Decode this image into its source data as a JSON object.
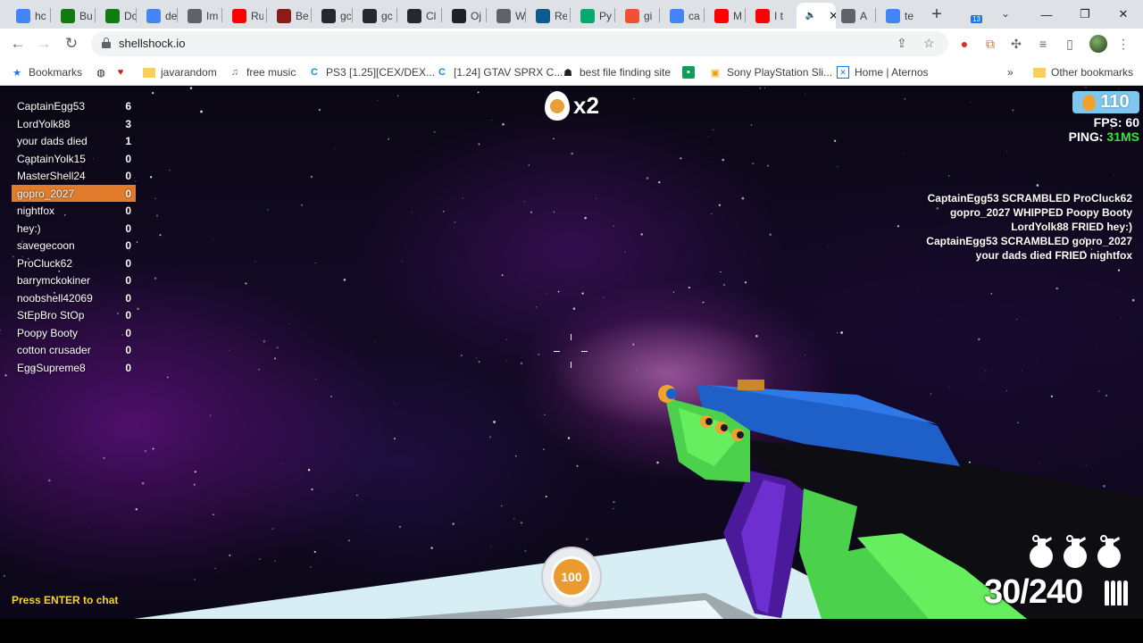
{
  "browser": {
    "tabs": [
      {
        "title": "hc",
        "icon": "google-icon",
        "color": "#4285f4"
      },
      {
        "title": "Bu",
        "icon": "xbox-icon",
        "color": "#107c10"
      },
      {
        "title": "Dc",
        "icon": "xbox-icon",
        "color": "#107c10"
      },
      {
        "title": "de",
        "icon": "google-icon",
        "color": "#4285f4"
      },
      {
        "title": "Im",
        "icon": "chart-icon",
        "color": "#5f6368"
      },
      {
        "title": "Ru",
        "icon": "youtube-icon",
        "color": "#ff0000"
      },
      {
        "title": "Be",
        "icon": "medium-icon",
        "color": "#8b1a1a"
      },
      {
        "title": "gc",
        "icon": "github-icon",
        "color": "#24292f"
      },
      {
        "title": "gc",
        "icon": "github-icon",
        "color": "#24292f"
      },
      {
        "title": "Cl",
        "icon": "github-icon",
        "color": "#24292f"
      },
      {
        "title": "Oj",
        "icon": "openai-icon",
        "color": "#202124"
      },
      {
        "title": "W",
        "icon": "globe-icon",
        "color": "#5f6368"
      },
      {
        "title": "Re",
        "icon": "replit-icon",
        "color": "#0f5a8c"
      },
      {
        "title": "Py",
        "icon": "w3-icon",
        "color": "#04aa6d"
      },
      {
        "title": "gi",
        "icon": "git-icon",
        "color": "#f05133"
      },
      {
        "title": "ca",
        "icon": "google-icon",
        "color": "#4285f4"
      },
      {
        "title": "M",
        "icon": "youtube-icon",
        "color": "#ff0000"
      },
      {
        "title": "I t",
        "icon": "youtube-icon",
        "color": "#ff0000"
      },
      {
        "title": "",
        "icon": "audio-icon",
        "color": "#202124",
        "active": true
      },
      {
        "title": "A",
        "icon": "image-icon",
        "color": "#5f6368"
      },
      {
        "title": "te",
        "icon": "google-icon",
        "color": "#4285f4"
      }
    ],
    "new_tab": "+",
    "tab_search": "⌄",
    "window": {
      "minimize": "—",
      "maximize": "❐",
      "close": "✕"
    },
    "url": "shellshock.io",
    "bookmarks": [
      {
        "label": "Bookmarks",
        "icon": "star-icon"
      },
      {
        "label": "",
        "icon": "globe-icon"
      },
      {
        "label": "",
        "icon": "heart-icon"
      },
      {
        "label": "javarandom",
        "icon": "folder-icon"
      },
      {
        "label": "free music",
        "icon": "music-icon"
      },
      {
        "label": "PS3 [1.25][CEX/DEX...",
        "icon": "c-icon"
      },
      {
        "label": "[1.24] GTAV SPRX C...",
        "icon": "c-icon"
      },
      {
        "label": "best file finding site",
        "icon": "robot-icon"
      },
      {
        "label": "",
        "icon": "app-icon"
      },
      {
        "label": "Sony PlayStation Sli...",
        "icon": "gift-icon"
      },
      {
        "label": "Home | Aternos",
        "icon": "aternos-icon"
      },
      {
        "label": "»",
        "icon": ""
      },
      {
        "label": "Other bookmarks",
        "icon": "folder-icon"
      }
    ],
    "extension_badge": "13"
  },
  "game": {
    "scoreboard": [
      {
        "name": "CaptainEgg53",
        "score": "6"
      },
      {
        "name": "LordYolk88",
        "score": "3"
      },
      {
        "name": "your dads died",
        "score": "1"
      },
      {
        "name": "CaptainYolk15",
        "score": "0"
      },
      {
        "name": "MasterShell24",
        "score": "0"
      },
      {
        "name": "gopro_2027",
        "score": "0",
        "me": true
      },
      {
        "name": "nightfox",
        "score": "0"
      },
      {
        "name": "hey:)",
        "score": "0"
      },
      {
        "name": "savegecoon",
        "score": "0"
      },
      {
        "name": "ProCluck62",
        "score": "0"
      },
      {
        "name": "barrymckokiner",
        "score": "0"
      },
      {
        "name": "noobshell42069",
        "score": "0"
      },
      {
        "name": "StEpBro StOp",
        "score": "0"
      },
      {
        "name": "Poopy Booty",
        "score": "0"
      },
      {
        "name": "cotton crusader",
        "score": "0"
      },
      {
        "name": "EggSupreme8",
        "score": "0"
      }
    ],
    "multiplier": "x2",
    "currency": "110",
    "fps_label": "FPS:",
    "fps_value": "60",
    "ping_label": "PING:",
    "ping_value": "31MS",
    "killfeed": [
      "CaptainEgg53 SCRAMBLED ProCluck62",
      "gopro_2027 WHIPPED Poopy Booty",
      "LordYolk88 FRIED hey:)",
      "CaptainEgg53 SCRAMBLED gopro_2027",
      "your dads died FRIED nightfox"
    ],
    "health": "100",
    "ammo": "30/240",
    "grenades": 3,
    "chat_hint": "Press ENTER to chat",
    "colors": {
      "highlight": "#e07c2b",
      "ping": "#37e636",
      "chat_hint": "#f5d531",
      "health": "#ea9a2f"
    }
  }
}
